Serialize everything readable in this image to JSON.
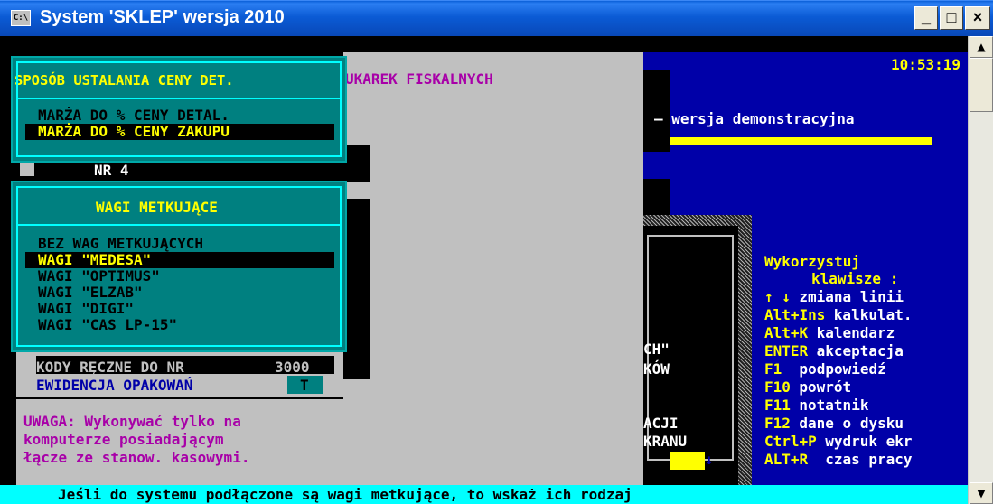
{
  "window": {
    "title": "System 'SKLEP' wersja 2010",
    "icon_label": "C:\\",
    "minimize_label": "_",
    "maximize_label": "□",
    "close_label": "×"
  },
  "clock": "10:53:19",
  "background": {
    "fiskal_header": "UKAREK FISKALNYCH",
    "demo_text": "— wersja demonstracyjna",
    "nr4_label": "NR 4",
    "fragment_ch": "CH\"",
    "fragment_kow": "KÓW",
    "fragment_acji": "ACJI",
    "fragment_kranu": "KRANU",
    "arrow_down": "↓"
  },
  "price_menu": {
    "title": "SPOSÓB USTALANIA CENY DET.",
    "items": [
      {
        "label": "MARŻA DO % CENY DETAL.",
        "selected": false
      },
      {
        "label": "MARŻA DO % CENY ZAKUPU",
        "selected": true
      }
    ]
  },
  "scales_menu": {
    "title": "WAGI METKUJĄCE",
    "items": [
      {
        "label": "BEZ WAG METKUJĄCYCH",
        "selected": false
      },
      {
        "label": "WAGI \"MEDESA\"",
        "selected": true
      },
      {
        "label": "WAGI \"OPTIMUS\"",
        "selected": false
      },
      {
        "label": "WAGI \"ELZAB\"",
        "selected": false
      },
      {
        "label": "WAGI \"DIGI\"",
        "selected": false
      },
      {
        "label": "WAGI \"CAS LP-15\"",
        "selected": false
      }
    ]
  },
  "settings": {
    "manual_codes_label": "KODY RĘCZNE DO NR",
    "manual_codes_value": "3000",
    "packaging_label": "EWIDENCJA OPAKOWAŃ",
    "packaging_value": "T"
  },
  "warning": {
    "line1": "UWAGA: Wykonywać tylko na",
    "line2": "komputerze posiadającym",
    "line3": "łącze ze stanow. kasowymi."
  },
  "help": {
    "title1": "Wykorzystuj",
    "title2": "klawisze :",
    "keys": [
      {
        "key": "↑ ↓",
        "desc": "zmiana linii"
      },
      {
        "key": "Alt+Ins",
        "desc": "kalkulat."
      },
      {
        "key": "Alt+K",
        "desc": "kalendarz"
      },
      {
        "key": "ENTER",
        "desc": "akceptacja"
      },
      {
        "key": "F1",
        "desc": " podpowiedź"
      },
      {
        "key": "F10",
        "desc": "powrót"
      },
      {
        "key": "F11",
        "desc": "notatnik"
      },
      {
        "key": "F12",
        "desc": "dane o dysku"
      },
      {
        "key": "Ctrl+P",
        "desc": "wydruk ekr"
      },
      {
        "key": "ALT+R",
        "desc": " czas pracy"
      }
    ]
  },
  "status_message": "Jeśli do systemu podłączone są wagi metkujące, to wskaż ich rodzaj",
  "scrollbar": {
    "up_label": "▲",
    "down_label": "▼"
  },
  "colors": {
    "console_blue": "#0000a8",
    "console_gray": "#c0c0c0",
    "menu_teal": "#008080",
    "highlight_yellow": "#ffff00",
    "status_cyan": "#00ffff"
  }
}
